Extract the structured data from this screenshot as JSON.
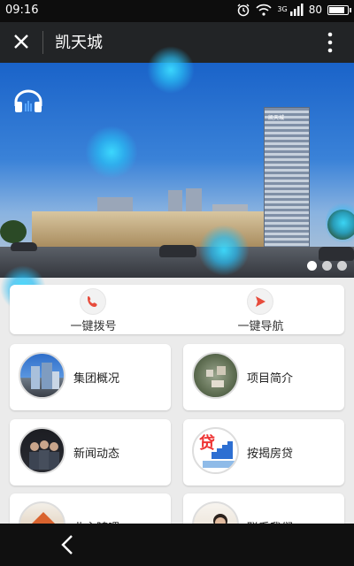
{
  "status_bar": {
    "time": "09:16",
    "network": "3G",
    "battery": "80"
  },
  "header": {
    "title": "凯天城",
    "close_icon": "close-icon",
    "more_icon": "more-vertical-icon"
  },
  "banner": {
    "tower_sign": "凯天城",
    "audio_icon": "headphone-icon",
    "slides": 3,
    "active_slide": 1
  },
  "actions": [
    {
      "label": "一键拨号",
      "icon": "phone-icon"
    },
    {
      "label": "一键导航",
      "icon": "navigation-icon"
    }
  ],
  "menu": [
    {
      "label": "集团概况"
    },
    {
      "label": "项目简介"
    },
    {
      "label": "新闻动态"
    },
    {
      "label": "按揭房贷",
      "thumb_text": "贷"
    },
    {
      "label": "业主随喂"
    },
    {
      "label": "联系我们"
    }
  ],
  "colors": {
    "accent": "#e74c3c",
    "orb": "#3cdcff",
    "header_bg": "#222426"
  }
}
